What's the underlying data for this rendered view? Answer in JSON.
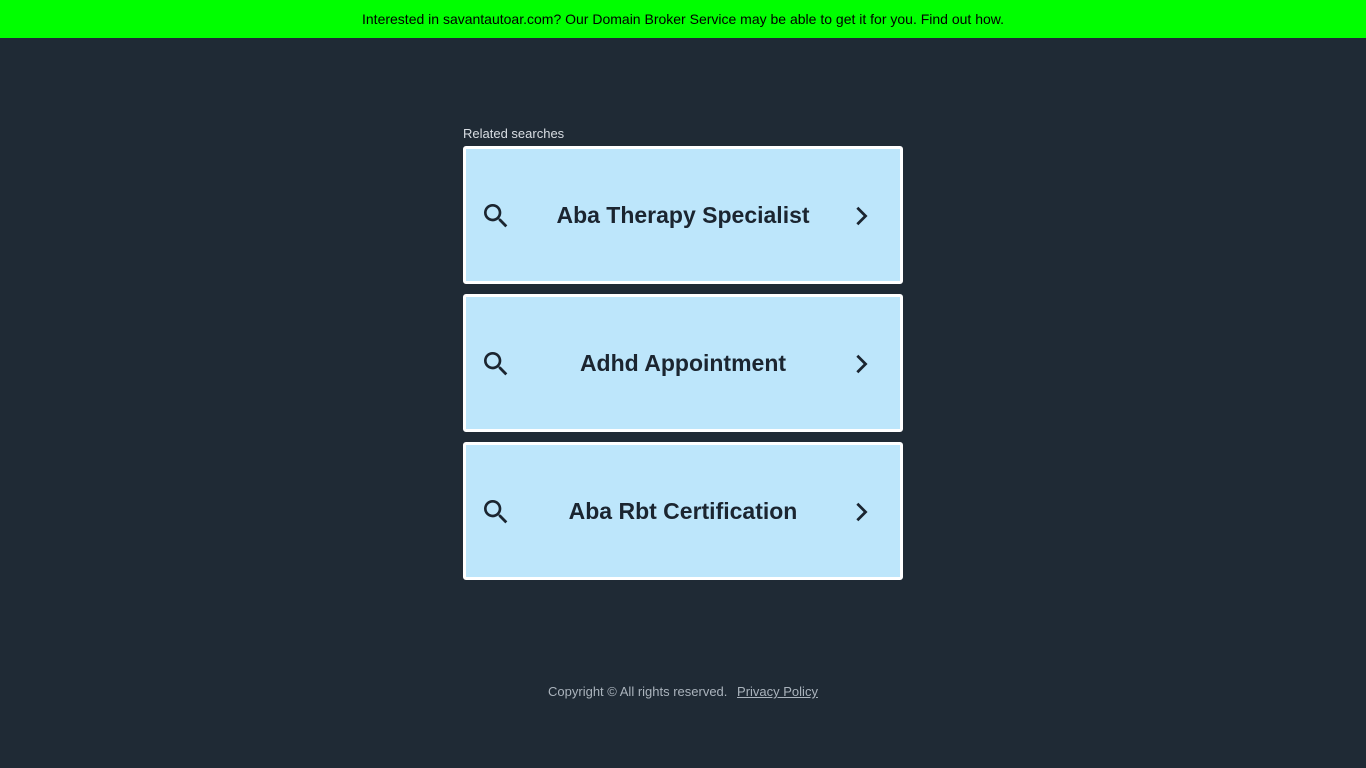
{
  "banner": {
    "text": "Interested in savantautoar.com? Our Domain Broker Service may be able to get it for you. Find out how.",
    "bg_color": "#00ff00"
  },
  "related": {
    "label": "Related searches",
    "items": [
      {
        "label": "Aba Therapy Specialist",
        "left_icon": "search-icon",
        "right_icon": "chevron-right-icon"
      },
      {
        "label": "Adhd Appointment",
        "left_icon": "search-icon",
        "right_icon": "chevron-right-icon"
      },
      {
        "label": "Aba Rbt Certification",
        "left_icon": "search-icon",
        "right_icon": "chevron-right-icon"
      }
    ],
    "card_color": "#bde6fb"
  },
  "footer": {
    "copyright": "Copyright ©  All rights reserved.",
    "privacy_label": "Privacy Policy"
  },
  "colors": {
    "page_bg": "#1f2a35"
  }
}
